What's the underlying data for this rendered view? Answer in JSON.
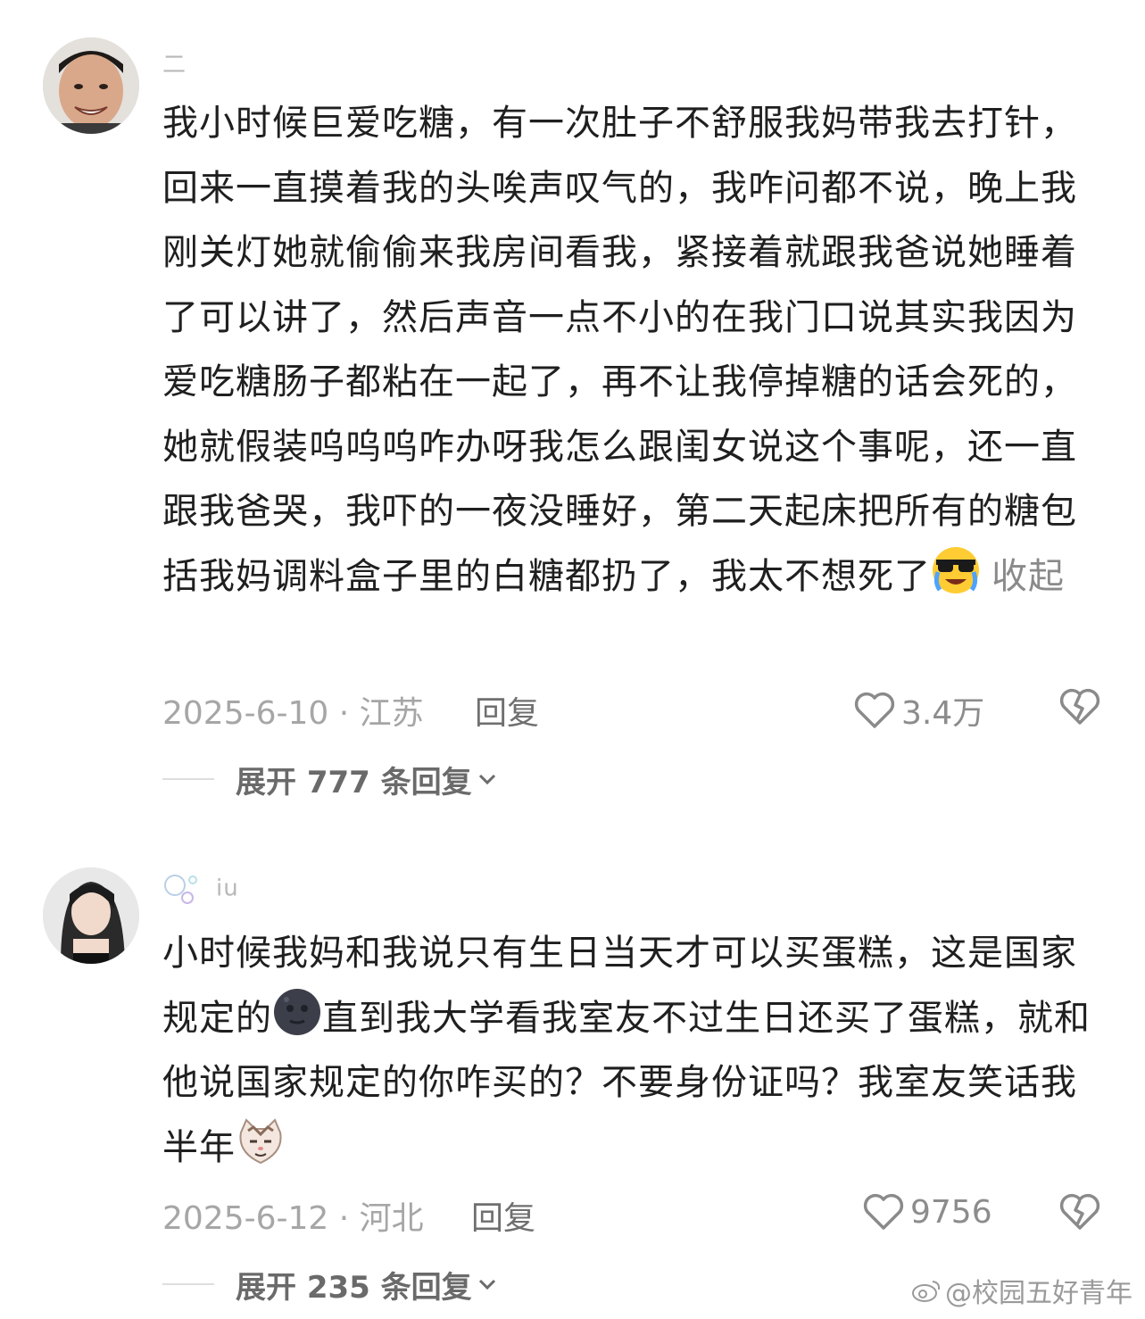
{
  "comments": [
    {
      "username": "二",
      "text": "我小时候巨爱吃糖，有一次肚子不舒服我妈带我去打针，回来一直摸着我的头唉声叹气的，我咋问都不说，晚上我刚关灯她就偷偷来我房间看我，紧接着就跟我爸说她睡着了可以讲了，然后声音一点不小的在我门口说其实我因为爱吃糖肠子都粘在一起了，再不让我停掉糖的话会死的，她就假装呜呜呜咋办呀我怎么跟闺女说这个事呢，还一直跟我爸哭，我吓的一夜没睡好，第二天起床把所有的糖包括我妈调料盒子里的白糖都扔了，我太不想死了",
      "emoji": "crying-sunglasses-emoji",
      "collapse_label": "收起",
      "date_location": "2025-6-10 · 江苏",
      "reply_label": "回复",
      "like_count": "3.4万",
      "expand_label": "展开 777 条回复"
    },
    {
      "username": "iu",
      "text_part1": "小时候我妈和我说只有生日当天才可以买蛋糕，这是国家规定的",
      "emoji1": "new-moon-face-emoji",
      "text_part2": "直到我大学看我室友不过生日还买了蛋糕，就和他说国家规定的你咋买的？不要身份证吗？我室友笑话我半年",
      "emoji2": "smug-cat-emoji",
      "date_location": "2025-6-12 · 河北",
      "reply_label": "回复",
      "like_count": "9756",
      "expand_label": "展开 235 条回复"
    }
  ],
  "watermark": "@校园五好青年",
  "icons": {
    "like": "heart-outline-icon",
    "dislike": "broken-heart-icon",
    "expand": "chevron-down-icon",
    "watermark_logo": "weibo-logo-icon"
  },
  "colors": {
    "text": "#1f1f1f",
    "meta": "#a6a6a6",
    "reply": "#6f6f6f",
    "expand": "#6a6a6a"
  }
}
